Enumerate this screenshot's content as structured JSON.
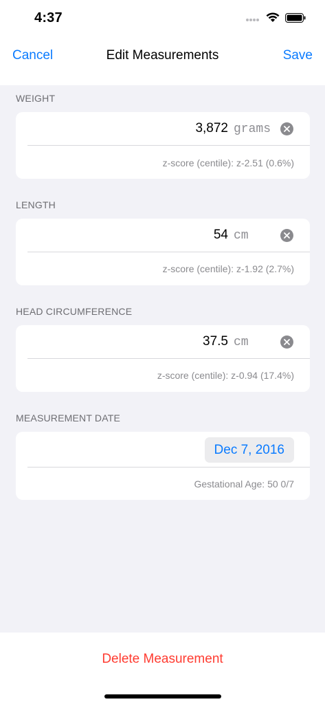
{
  "status_bar": {
    "time": "4:37"
  },
  "nav": {
    "cancel_label": "Cancel",
    "title": "Edit Measurements",
    "save_label": "Save"
  },
  "weight": {
    "header": "WEIGHT",
    "value": "3,872",
    "unit": "grams",
    "zscore": "z-score (centile): z-2.51 (0.6%)"
  },
  "length": {
    "header": "LENGTH",
    "value": "54",
    "unit": "cm",
    "zscore": "z-score (centile): z-1.92 (2.7%)"
  },
  "head": {
    "header": "HEAD CIRCUMFERENCE",
    "value": "37.5",
    "unit": "cm",
    "zscore": "z-score (centile): z-0.94 (17.4%)"
  },
  "date": {
    "header": "MEASUREMENT DATE",
    "value": "Dec 7, 2016",
    "gestational_age": "Gestational Age: 50 0/7"
  },
  "footer": {
    "delete_label": "Delete Measurement"
  },
  "colors": {
    "accent": "#0a7bff",
    "destructive": "#ff3b30",
    "background": "#f2f2f7"
  },
  "icons": {
    "signal": "cellular-signal-icon",
    "wifi": "wifi-icon",
    "battery": "battery-icon",
    "clear": "clear-circle-icon"
  }
}
